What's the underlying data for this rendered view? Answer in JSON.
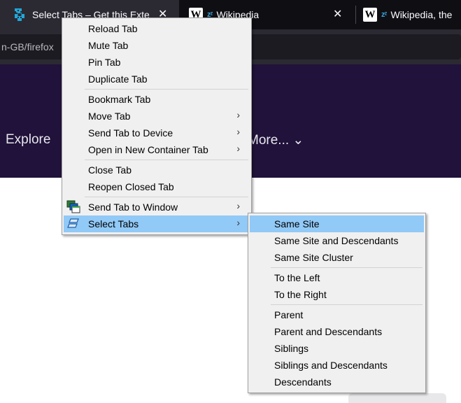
{
  "tabs": [
    {
      "title": "Select Tabs – Get this Exte",
      "close": "✕",
      "icon": "puzzle-extension-icon"
    },
    {
      "title": "Wikipedia",
      "close": "✕",
      "favicon": "W",
      "indicator": "zᶻ"
    },
    {
      "title": "Wikipedia, the",
      "favicon": "W",
      "indicator": "zᶻ"
    }
  ],
  "url": "n-GB/firefox",
  "page": {
    "nav_explore": "Explore",
    "nav_more": "More... ⌄"
  },
  "context_menu": {
    "items": [
      {
        "label": "Reload Tab",
        "group": 1
      },
      {
        "label": "Mute Tab",
        "group": 1
      },
      {
        "label": "Pin Tab",
        "group": 1
      },
      {
        "label": "Duplicate Tab",
        "group": 1
      },
      {
        "label": "Bookmark Tab",
        "group": 2
      },
      {
        "label": "Move Tab",
        "submenu": true,
        "group": 2
      },
      {
        "label": "Send Tab to Device",
        "submenu": true,
        "group": 2
      },
      {
        "label": "Open in New Container Tab",
        "submenu": true,
        "group": 2
      },
      {
        "label": "Close Tab",
        "group": 3
      },
      {
        "label": "Reopen Closed Tab",
        "group": 3
      },
      {
        "label": "Send Tab to Window",
        "submenu": true,
        "icon": "windows-icon",
        "group": 4
      },
      {
        "label": "Select Tabs",
        "submenu": true,
        "icon": "select-tabs-icon",
        "highlighted": true,
        "group": 4
      }
    ],
    "arrow": "›"
  },
  "select_tabs_submenu": {
    "items": [
      {
        "label": "Same Site",
        "highlighted": true,
        "group": 1
      },
      {
        "label": "Same Site and Descendants",
        "group": 1
      },
      {
        "label": "Same Site Cluster",
        "group": 1
      },
      {
        "label": "To the Left",
        "group": 2
      },
      {
        "label": "To the Right",
        "group": 2
      },
      {
        "label": "Parent",
        "group": 3
      },
      {
        "label": "Parent and Descendants",
        "group": 3
      },
      {
        "label": "Siblings",
        "group": 3
      },
      {
        "label": "Siblings and Descendants",
        "group": 3
      },
      {
        "label": "Descendants",
        "group": 3
      }
    ]
  },
  "colors": {
    "menu_bg": "#f0f0f0",
    "menu_highlight": "#91c9f7",
    "header_purple": "#20123a",
    "tabbar_bg": "#0f0e13",
    "active_tab_bg": "#2b2a33"
  }
}
